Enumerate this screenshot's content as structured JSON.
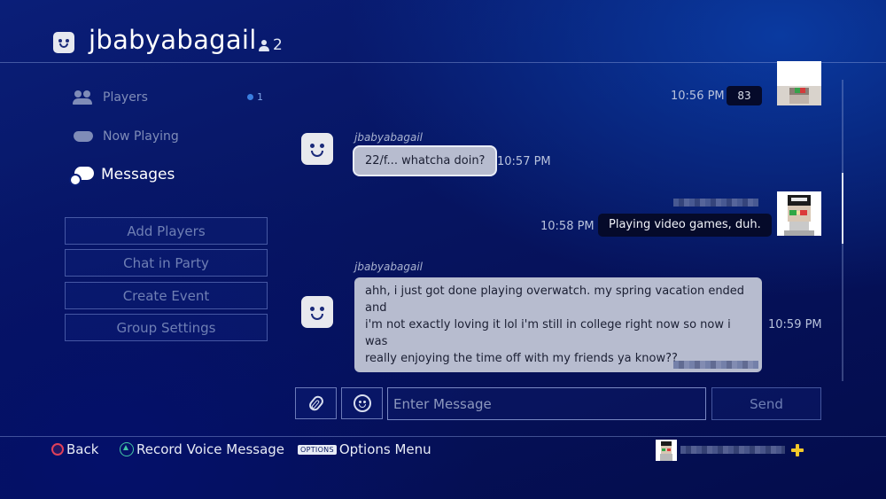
{
  "header": {
    "title": "jbabyabagail",
    "member_count": "2"
  },
  "sidebar": {
    "nav": [
      {
        "label": "Players",
        "badge": "1"
      },
      {
        "label": "Now Playing"
      },
      {
        "label": "Messages"
      }
    ],
    "actions": [
      "Add Players",
      "Chat in Party",
      "Create Event",
      "Group Settings"
    ]
  },
  "chat": {
    "messages": [
      {
        "direction": "out",
        "time": "10:56 PM",
        "text": "83"
      },
      {
        "direction": "in",
        "sender": "jbabyabagail",
        "time": "10:57 PM",
        "text": "22/f... whatcha doin?"
      },
      {
        "direction": "out",
        "time": "10:58 PM",
        "text": "Playing video games, duh."
      },
      {
        "direction": "in",
        "sender": "jbabyabagail",
        "time": "10:59 PM",
        "lines": [
          "ahh, i just got done playing overwatch. my spring vacation ended and",
          "i'm not exactly loving it lol i'm still in college right now so now i was",
          "really enjoying the time off with my friends ya know??"
        ]
      }
    ]
  },
  "composer": {
    "placeholder": "Enter Message",
    "send_label": "Send",
    "attach_icon": "paperclip-icon",
    "emoji_icon": "smiley-icon"
  },
  "footer": {
    "back": "Back",
    "record": "Record Voice Message",
    "options_key": "OPTIONS",
    "options": "Options Menu"
  },
  "colors": {
    "background": "#061460",
    "incoming_bubble": "#b7bccf",
    "outgoing_bubble": "#050a2a",
    "plus": "#f3c82a"
  }
}
